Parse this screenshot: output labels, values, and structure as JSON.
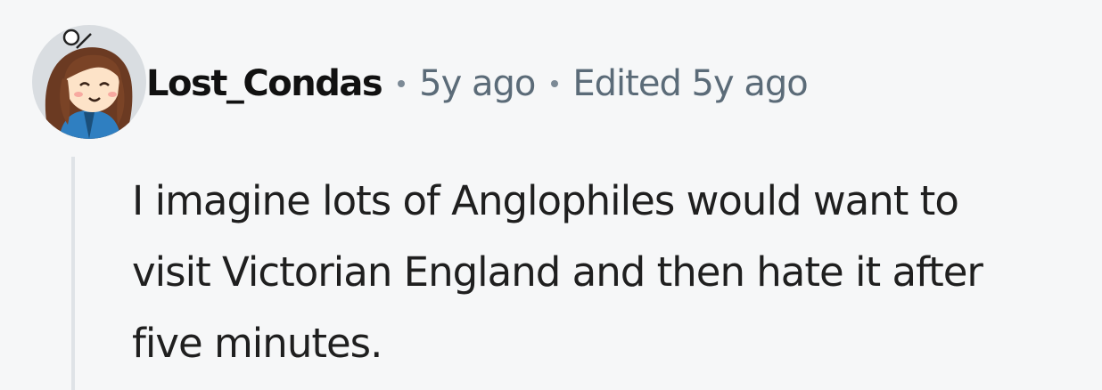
{
  "comment": {
    "username": "Lost_Condas",
    "posted": "5y ago",
    "edited": "Edited 5y ago",
    "body_lines": [
      "I imagine lots of Anglophiles would want to",
      "visit Victorian England and then hate it after",
      "five minutes."
    ],
    "avatar_icon": "cartoon-girl-avatar",
    "colors": {
      "background": "#f6f7f8",
      "meta_text": "#5b6b78",
      "thread_line": "#dfe3e7"
    }
  }
}
